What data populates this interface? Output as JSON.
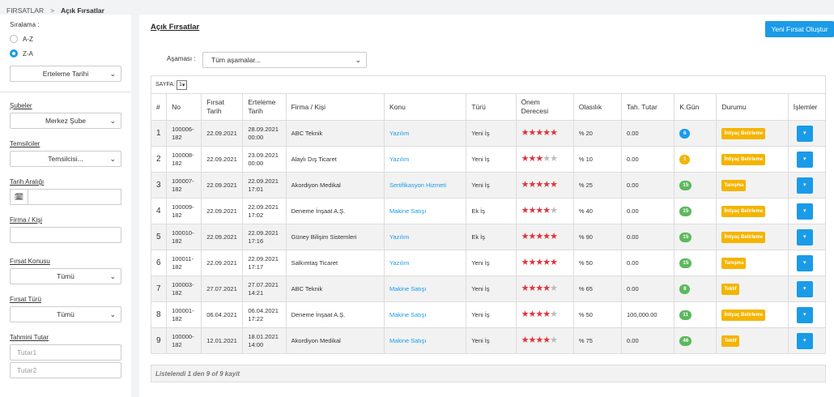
{
  "breadcrumb": {
    "root": "FIRSATLAR",
    "sep": ">",
    "current": "Açık Fırsatlar"
  },
  "sidebar": {
    "sort_label": "Sıralama :",
    "sort_opt1": "A-Z",
    "sort_opt2": "Z-A",
    "sort_field": "Erteleme Tarihi",
    "branches_label": "Şubeler",
    "branch_value": "Merkez Şube",
    "reps_label": "Temsilciler",
    "reps_value": "Temsilcisi...",
    "date_label": "Tarih Aralığı",
    "company_label": "Firma / Kişi",
    "topic_label": "Fırsat Konusu",
    "topic_value": "Tümü",
    "type_label": "Fırsat Türü",
    "type_value": "Tümü",
    "estimate_label": "Tahmini Tutar",
    "amount1_placeholder": "Tutar1",
    "amount2_placeholder": "Tutar2"
  },
  "main": {
    "title": "Açık Fırsatlar",
    "new_button": "Yeni Fırsat Oluştur",
    "stage_label": "Aşaması :",
    "stage_value": "Tüm aşamalar...",
    "page_label": "SAYFA:",
    "page_value": "1",
    "footer": "Listelendi 1 den 9 of 9 kayit",
    "columns": [
      "#",
      "No",
      "Fırsat Tarih",
      "Erteleme Tarih",
      "Firma / Kişi",
      "Konu",
      "Türü",
      "Önem Derecesi",
      "Olasılık",
      "Tah. Tutar",
      "K.Gün",
      "Durumu",
      "İşlemler"
    ]
  },
  "rows": [
    {
      "idx": "1",
      "no": "100006-182",
      "date": "22.09.2021",
      "postpone": "28.09.2021 00:00",
      "company": "ABC Teknik",
      "topic": "Yazılım",
      "type": "Yeni İş",
      "stars": 5,
      "prob": "% 20",
      "amount": "0.00",
      "days": "6",
      "days_color": "blue",
      "status": "İhtiyaç Belirleme"
    },
    {
      "idx": "2",
      "no": "100008-182",
      "date": "22.09.2021",
      "postpone": "23.09.2021 00:00",
      "company": "Alaylı Dış Ticaret",
      "topic": "Yazılım",
      "type": "Yeni İş",
      "stars": 3,
      "prob": "% 10",
      "amount": "0.00",
      "days": "1",
      "days_color": "yellow",
      "status": "İhtiyaç Belirleme"
    },
    {
      "idx": "3",
      "no": "100007-182",
      "date": "22.09.2021",
      "postpone": "22.09.2021 17:01",
      "company": "Akordiyon Medikal",
      "topic": "Sertifikasyon Hizmeti",
      "type": "Yeni İş",
      "stars": 5,
      "prob": "% 25",
      "amount": "0.00",
      "days": "15",
      "days_color": "green",
      "status": "Tanışma"
    },
    {
      "idx": "4",
      "no": "100009-182",
      "date": "22.09.2021",
      "postpone": "22.09.2021 17:02",
      "company": "Deneme İnşaat A.Ş.",
      "topic": "Makine Satışı",
      "type": "Ek İş",
      "stars": 4,
      "prob": "% 40",
      "amount": "0.00",
      "days": "15",
      "days_color": "green",
      "status": "İhtiyaç Belirleme"
    },
    {
      "idx": "5",
      "no": "100010-182",
      "date": "22.09.2021",
      "postpone": "22.09.2021 17:16",
      "company": "Güney Bilişim Sistemleri",
      "topic": "Yazılım",
      "type": "Ek İş",
      "stars": 5,
      "prob": "% 90",
      "amount": "0.00",
      "days": "15",
      "days_color": "green",
      "status": "İhtiyaç Belirleme"
    },
    {
      "idx": "6",
      "no": "100011-182",
      "date": "22.09.2021",
      "postpone": "22.09.2021 17:17",
      "company": "Salkımtaş Ticaret",
      "topic": "Yazılım",
      "type": "Yeni İş",
      "stars": 5,
      "prob": "% 50",
      "amount": "0.00",
      "days": "15",
      "days_color": "green",
      "status": "Tanışma"
    },
    {
      "idx": "7",
      "no": "100003-182",
      "date": "27.07.2021",
      "postpone": "27.07.2021 14:21",
      "company": "ABC Teknik",
      "topic": "Makine Satışı",
      "type": "Yeni İş",
      "stars": 4,
      "prob": "% 65",
      "amount": "0.00",
      "days": "8",
      "days_color": "green",
      "status": "Teklif"
    },
    {
      "idx": "8",
      "no": "100001-182",
      "date": "06.04.2021",
      "postpone": "06.04.2021 17:22",
      "company": "Deneme İnşaat A.Ş.",
      "topic": "Makine Satışı",
      "type": "Yeni İş",
      "stars": 4,
      "prob": "% 50",
      "amount": "100,000.00",
      "days": "11",
      "days_color": "green",
      "status": "İhtiyaç Belirleme"
    },
    {
      "idx": "9",
      "no": "100000-182",
      "date": "12.01.2021",
      "postpone": "18.01.2021 14:00",
      "company": "Akordiyon Medikal",
      "topic": "Makine Satışı",
      "type": "Yeni İş",
      "stars": 4,
      "prob": "% 75",
      "amount": "0.00",
      "days": "46",
      "days_color": "green",
      "status": "Teklif"
    }
  ],
  "icons": {
    "calendar": "calendar-icon",
    "chevron": "chevron-down-icon",
    "star": "star-icon",
    "action": "caret-down-icon"
  },
  "colors": {
    "accent": "#1a9be8",
    "star": "#e0323c",
    "status": "#f4b400",
    "badge_green": "#5cb85c",
    "badge_yellow": "#f4b400",
    "badge_blue": "#1a9be8"
  }
}
